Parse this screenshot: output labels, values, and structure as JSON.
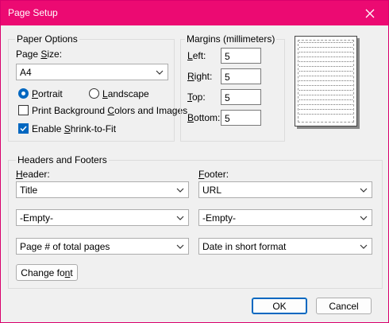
{
  "window": {
    "title": "Page Setup"
  },
  "paper_options": {
    "group_title": "Paper Options",
    "page_size_label_pre": "Page ",
    "page_size_label_u": "S",
    "page_size_label_post": "ize:",
    "page_size_value": "A4",
    "portrait_pre": "",
    "portrait_u": "P",
    "portrait_post": "ortrait",
    "portrait_selected": true,
    "landscape_pre": "",
    "landscape_u": "L",
    "landscape_post": "andscape",
    "landscape_selected": false,
    "print_bg_pre": "Print Background ",
    "print_bg_u": "C",
    "print_bg_post": "olors and Images",
    "print_bg_checked": false,
    "shrink_pre": "Enable ",
    "shrink_u": "S",
    "shrink_post": "hrink-to-Fit",
    "shrink_checked": true
  },
  "margins": {
    "group_title": "Margins (millimeters)",
    "left_u": "L",
    "left_post": "eft:",
    "left_value": "5",
    "right_u": "R",
    "right_post": "ight:",
    "right_value": "5",
    "top_u": "T",
    "top_post": "op:",
    "top_value": "5",
    "bottom_u": "B",
    "bottom_post": "ottom:",
    "bottom_value": "5"
  },
  "headers_footers": {
    "group_title": "Headers and Footers",
    "header_u": "H",
    "header_post": "eader:",
    "footer_u": "F",
    "footer_post": "ooter:",
    "header_values": [
      "Title",
      "-Empty-",
      "Page # of total pages"
    ],
    "footer_values": [
      "URL",
      "-Empty-",
      "Date in short format"
    ],
    "change_font_pre": "Change fo",
    "change_font_u": "n",
    "change_font_post": "t"
  },
  "buttons": {
    "ok": "OK",
    "cancel": "Cancel"
  },
  "colors": {
    "titlebar": "#ec0a72",
    "accent": "#0067c0"
  }
}
